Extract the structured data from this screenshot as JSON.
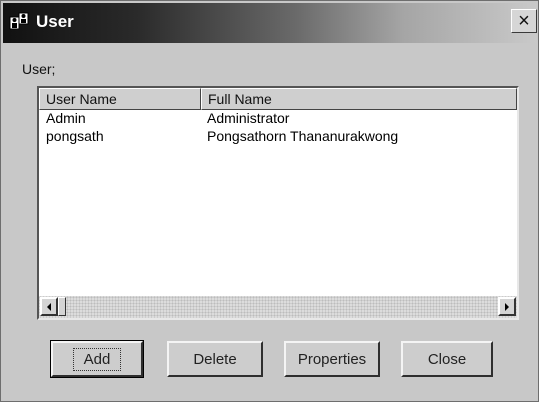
{
  "window": {
    "title": "User",
    "close_symbol": "×"
  },
  "user_label": "User;",
  "columns": [
    "User Name",
    "Full Name"
  ],
  "rows": [
    {
      "user_name": "Admin",
      "full_name": "Administrator"
    },
    {
      "user_name": "pongsath",
      "full_name": "Pongsathorn Thananurakwong"
    }
  ],
  "buttons": {
    "add": "Add",
    "delete": "Delete",
    "properties": "Properties",
    "close": "Close"
  },
  "icons": {
    "title": "users-icon",
    "close": "close-icon",
    "scroll_left": "arrow-left-icon",
    "scroll_right": "arrow-right-icon"
  }
}
